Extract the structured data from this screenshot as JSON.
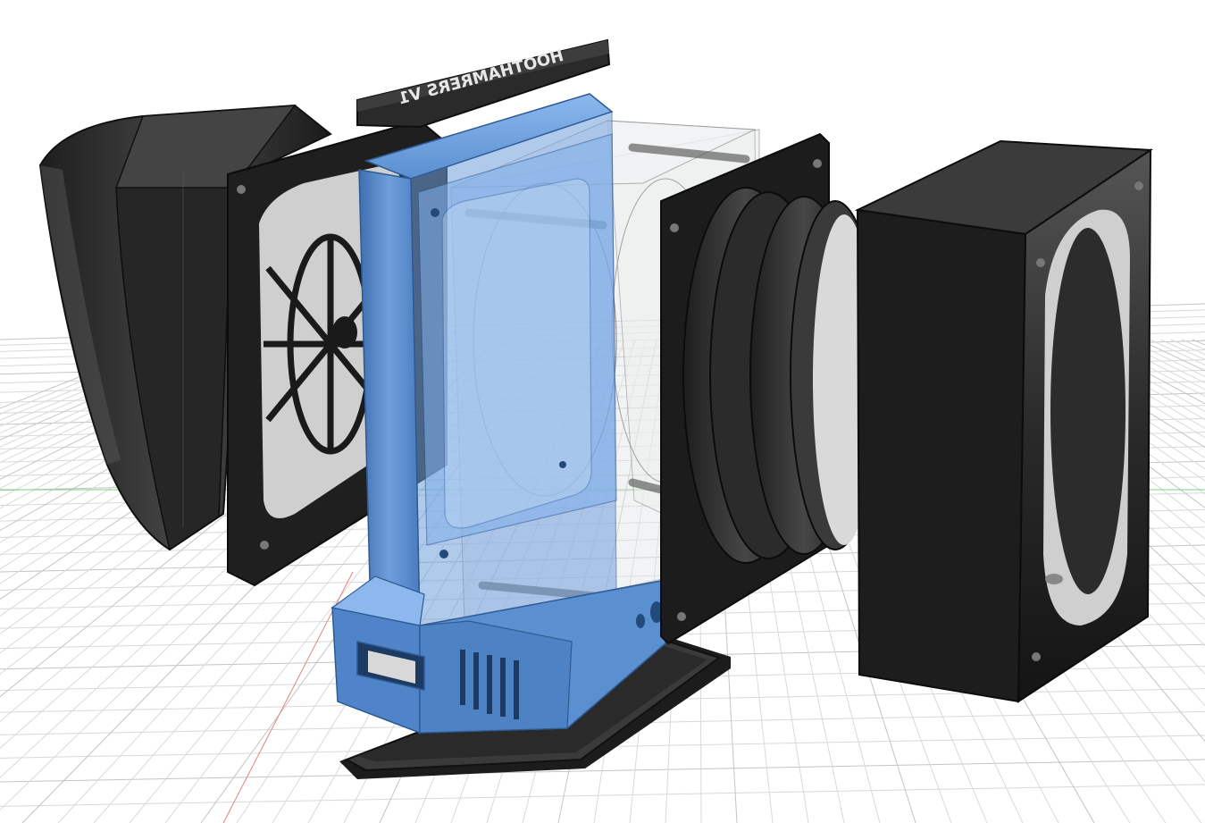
{
  "viewport": {
    "background": "#ffffff",
    "grid_color": "#d9d9d9",
    "grid_major_color": "#c4c4c4",
    "axis_x_color": "#e06060",
    "axis_y_color": "#5cc45c"
  },
  "colors": {
    "black_part": "#2b2b2b",
    "black_part_dark": "#151515",
    "black_part_light": "#4a4a4a",
    "blue_part": "#5a8fd0",
    "blue_part_dark": "#3f6fae",
    "blue_part_light": "#7fb0ea",
    "glass": "#d6d9dc",
    "glass_edge": "#6a6a6a"
  },
  "parts": {
    "label_plate": {
      "text": "HOOTHAMRERS V1"
    },
    "left_fan_shroud": {},
    "left_fan_grill": {},
    "blue_housing": {},
    "glass_chamber": {},
    "right_flange": {},
    "right_fan_box": {},
    "base_plate": {}
  }
}
